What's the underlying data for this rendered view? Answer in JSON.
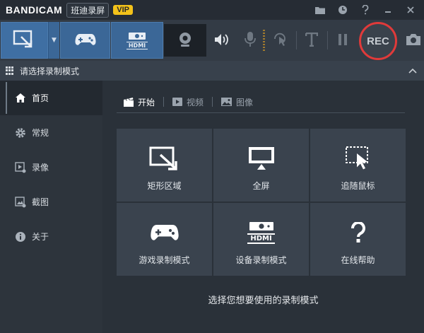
{
  "app": {
    "logo": "BANDICAM",
    "subtitle": "班迪录屏",
    "vip": "VIP"
  },
  "title_icons": [
    "folder-icon",
    "clock-icon",
    "help-icon",
    "minimize-icon",
    "close-icon"
  ],
  "toolbar": {
    "rec_label": "REC",
    "modes": [
      "screen-rectangle-mode",
      "game-mode",
      "hdmi-device-mode"
    ],
    "hdmi_text": "HDMI"
  },
  "mode_strip": {
    "label": "请选择录制模式"
  },
  "sidebar": {
    "items": [
      {
        "label": "首页",
        "icon": "home-icon",
        "active": true
      },
      {
        "label": "常规",
        "icon": "gear-icon",
        "active": false
      },
      {
        "label": "录像",
        "icon": "video-icon",
        "active": false
      },
      {
        "label": "截图",
        "icon": "screenshot-icon",
        "active": false
      },
      {
        "label": "关于",
        "icon": "info-icon",
        "active": false
      }
    ]
  },
  "tabs": [
    {
      "label": "开始",
      "icon": "clapper-icon",
      "active": true
    },
    {
      "label": "视频",
      "icon": "play-icon",
      "active": false
    },
    {
      "label": "图像",
      "icon": "image-icon",
      "active": false
    }
  ],
  "tiles": [
    {
      "label": "矩形区域",
      "icon": "rectangle-area-icon"
    },
    {
      "label": "全屏",
      "icon": "monitor-icon"
    },
    {
      "label": "追随鼠标",
      "icon": "follow-mouse-icon"
    },
    {
      "label": "游戏录制模式",
      "icon": "gamepad-icon"
    },
    {
      "label": "设备录制模式",
      "icon": "hdmi-icon"
    },
    {
      "label": "在线帮助",
      "icon": "question-icon"
    }
  ],
  "tile_hdmi_text": "HDMI",
  "hint": "选择您想要使用的录制模式",
  "colors": {
    "accent": "#3b6797",
    "rec_ring": "#e03a3a",
    "vip": "#f3c21a"
  }
}
